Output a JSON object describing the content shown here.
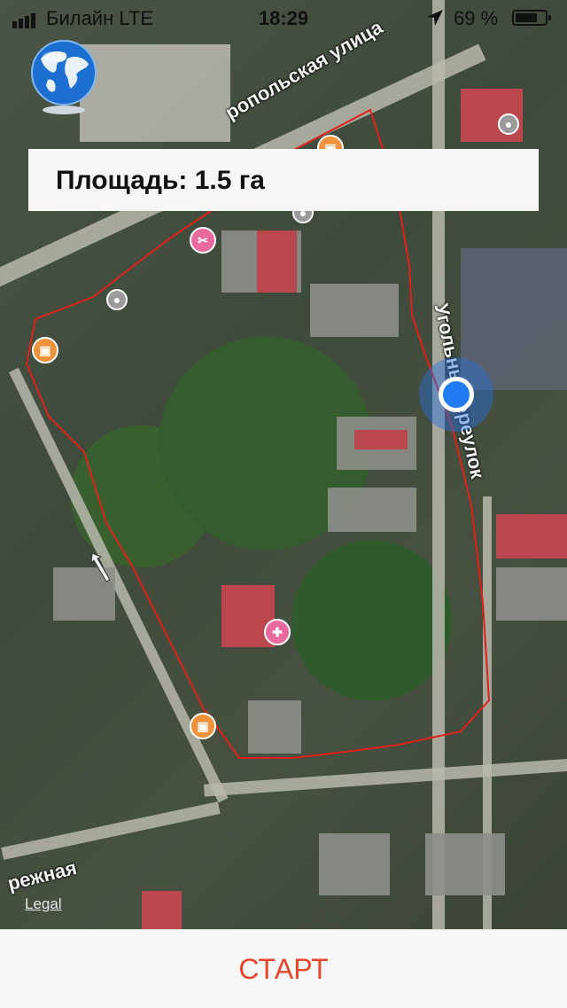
{
  "status_bar": {
    "carrier": "Билайн  LTE",
    "time": "18:29",
    "battery_percent": "69 %"
  },
  "area_label": "Площадь: 1.5 га",
  "streets": {
    "top": "ропольская улица",
    "right": "Угольны переулок",
    "bottom_left": "режная"
  },
  "map": {
    "legal_link": "Legal"
  },
  "icons": {
    "globe": "globe-icon",
    "location_arrow": "location-arrow-icon",
    "cafe": "cafe-icon",
    "hair_salon": "hair-salon-icon",
    "medical": "stethoscope-icon"
  },
  "colors": {
    "boundary": "#e0201b",
    "start_text": "#e8452c",
    "user_dot": "#1f7cf3"
  },
  "start_button_label": "СТАРТ"
}
